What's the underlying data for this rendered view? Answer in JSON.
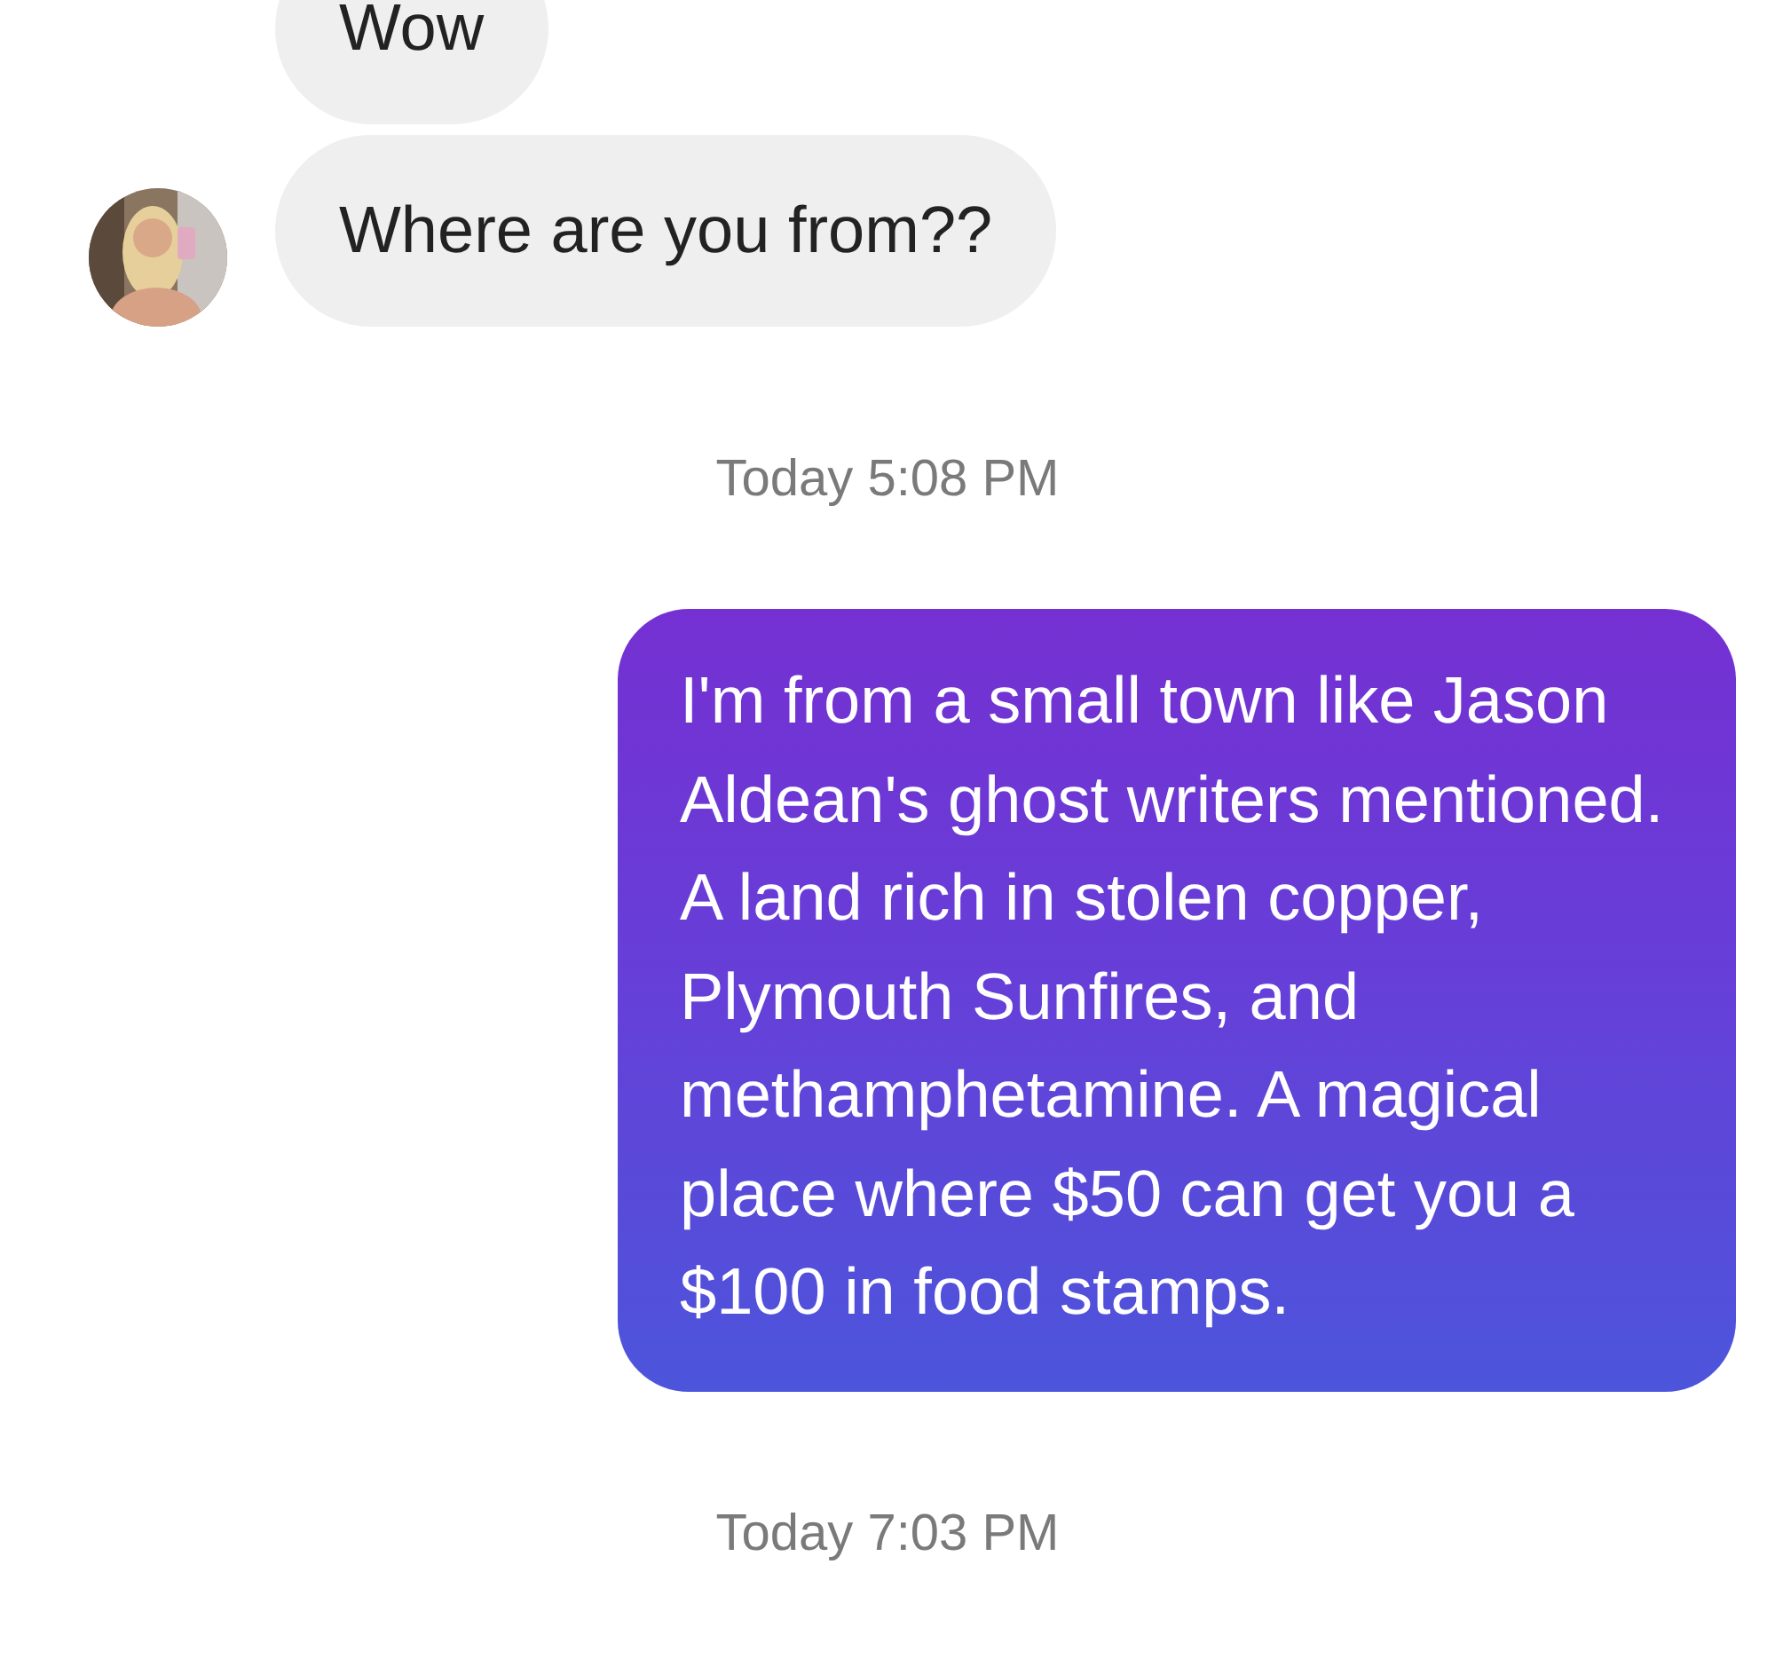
{
  "messages": [
    {
      "kind": "received",
      "text": "Wow",
      "avatar": false
    },
    {
      "kind": "received",
      "text": "Where are you from??",
      "avatar": true
    },
    {
      "kind": "timestamp",
      "text": "Today 5:08 PM"
    },
    {
      "kind": "sent",
      "text": "I'm from a small town like Jason Aldean's ghost writers mentioned. A land rich in stolen copper, Plymouth Sunfires, and methamphetamine. A magical place where $50 can get you a $100 in food stamps."
    },
    {
      "kind": "timestamp",
      "text": "Today 7:03 PM"
    }
  ]
}
